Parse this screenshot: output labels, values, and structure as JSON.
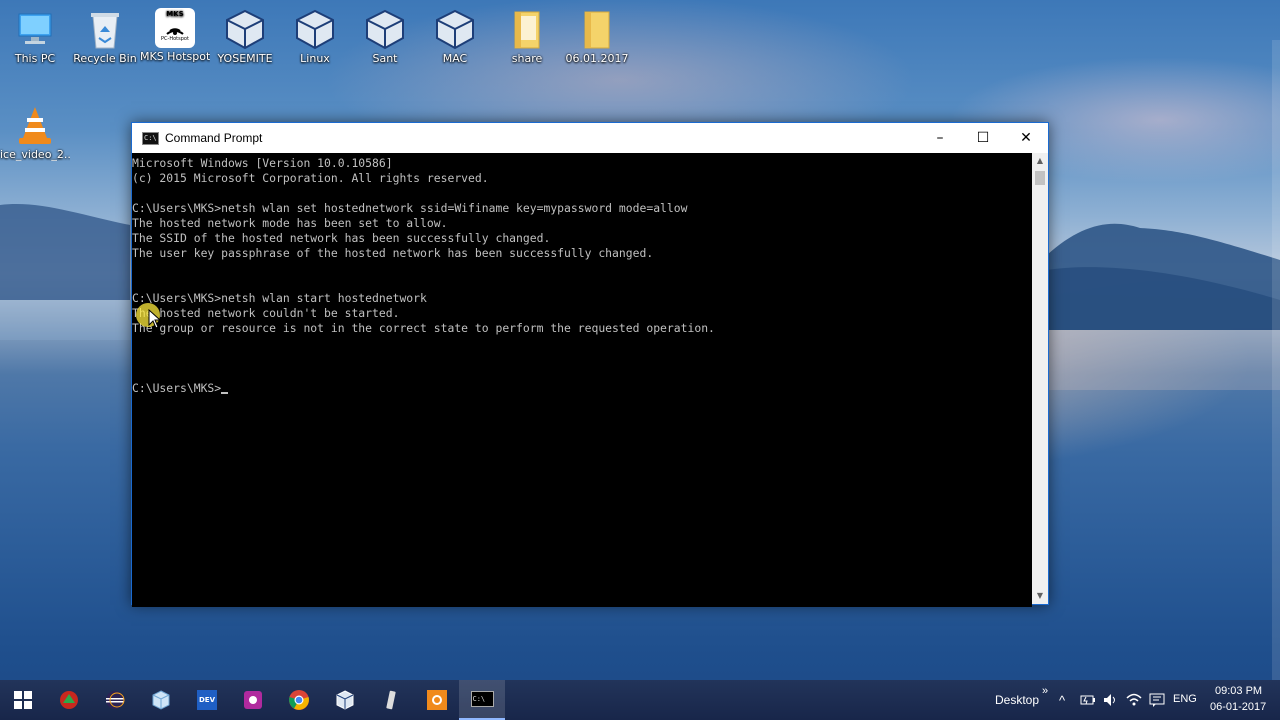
{
  "desktop": {
    "icons": [
      {
        "label": "This PC",
        "icon": "this-pc-icon"
      },
      {
        "label": "Recycle Bin",
        "icon": "recycle-bin-icon"
      },
      {
        "label": "MKS Hotspot",
        "icon": "mks-hotspot-icon",
        "badge_text": "MKS",
        "badge_sub": "PC-Hotspot"
      },
      {
        "label": "YOSEMITE",
        "icon": "virtualbox-icon"
      },
      {
        "label": "Linux",
        "icon": "virtualbox-icon"
      },
      {
        "label": "Sant",
        "icon": "virtualbox-icon"
      },
      {
        "label": "MAC",
        "icon": "virtualbox-icon"
      },
      {
        "label": "share",
        "icon": "folder-icon"
      },
      {
        "label": "06.01.2017",
        "icon": "folder-icon"
      },
      {
        "label": "ice_video_2...",
        "icon": "vlc-icon"
      }
    ]
  },
  "window": {
    "title": "Command Prompt",
    "icon_text": "C:\\",
    "controls": {
      "minimize": "–",
      "maximize": "☐",
      "close": "✕"
    }
  },
  "console": {
    "lines": [
      "Microsoft Windows [Version 10.0.10586]",
      "(c) 2015 Microsoft Corporation. All rights reserved.",
      "",
      "C:\\Users\\MKS>netsh wlan set hostednetwork ssid=Wifiname key=mypassword mode=allow",
      "The hosted network mode has been set to allow.",
      "The SSID of the hosted network has been successfully changed.",
      "The user key passphrase of the hosted network has been successfully changed.",
      "",
      "",
      "C:\\Users\\MKS>netsh wlan start hostednetwork",
      "The hosted network couldn't be started.",
      "The group or resource is not in the correct state to perform the requested operation.",
      "",
      "",
      "",
      "C:\\Users\\MKS>"
    ]
  },
  "taskbar": {
    "items": [
      {
        "name": "start-button",
        "icon": "windows-logo-icon"
      },
      {
        "name": "taskbar-app-1",
        "icon": "red-green-app-icon"
      },
      {
        "name": "taskbar-app-2",
        "icon": "eclipse-icon"
      },
      {
        "name": "taskbar-app-3",
        "icon": "cube-icon"
      },
      {
        "name": "taskbar-app-4",
        "icon": "dev-app-icon",
        "text": "DEV"
      },
      {
        "name": "taskbar-app-5",
        "icon": "purple-app-icon"
      },
      {
        "name": "taskbar-app-6",
        "icon": "chrome-icon"
      },
      {
        "name": "taskbar-app-7",
        "icon": "virtualbox-icon"
      },
      {
        "name": "taskbar-app-8",
        "icon": "phone-icon"
      },
      {
        "name": "taskbar-app-9",
        "icon": "orange-app-icon"
      },
      {
        "name": "taskbar-app-10",
        "icon": "command-prompt-icon"
      }
    ],
    "desktop_label": "Desktop",
    "desktop_chevron": "»",
    "tray": {
      "up_arrow": "^",
      "language": "ENG",
      "time": "09:03 PM",
      "date": "06-01-2017"
    }
  },
  "colors": {
    "console_bg": "#000000",
    "console_fg": "#c0c0c0",
    "taskbar_bg": "#1c2a4a",
    "window_border": "#1a6ad0"
  }
}
